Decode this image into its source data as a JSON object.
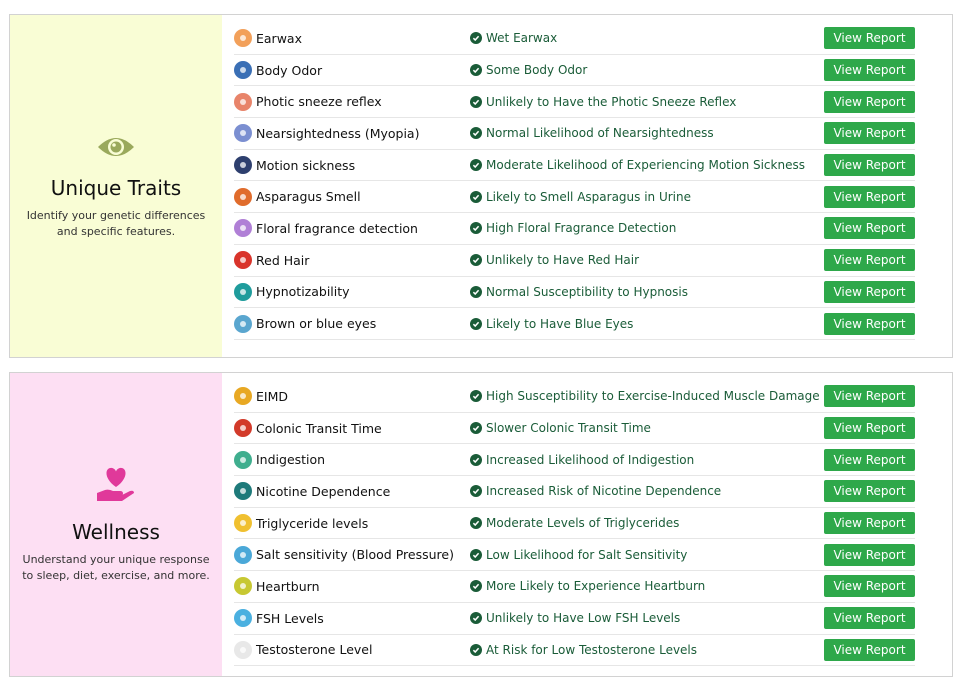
{
  "traits": {
    "title": "Unique Traits",
    "description": "Identify your genetic differences and specific features.",
    "rows": [
      {
        "name": "Earwax",
        "result": "Wet Earwax",
        "button": "View Report",
        "icon": "ear-icon",
        "color": "#f2a05a"
      },
      {
        "name": "Body Odor",
        "result": "Some Body Odor",
        "button": "View Report",
        "icon": "odor-waves-icon",
        "color": "#3a6fb5"
      },
      {
        "name": "Photic sneeze reflex",
        "result": "Unlikely to Have the Photic Sneeze Reflex",
        "button": "View Report",
        "icon": "tissue-icon",
        "color": "#e8846a"
      },
      {
        "name": "Nearsightedness (Myopia)",
        "result": "Normal Likelihood of Nearsightedness",
        "button": "View Report",
        "icon": "glasses-icon",
        "color": "#7b8fd1"
      },
      {
        "name": "Motion sickness",
        "result": "Moderate Likelihood of Experiencing Motion Sickness",
        "button": "View Report",
        "icon": "boat-icon",
        "color": "#2e3f6e"
      },
      {
        "name": "Asparagus Smell",
        "result": "Likely to Smell Asparagus in Urine",
        "button": "View Report",
        "icon": "asparagus-icon",
        "color": "#e06c2c"
      },
      {
        "name": "Floral fragrance detection",
        "result": "High Floral Fragrance Detection",
        "button": "View Report",
        "icon": "flower-icon",
        "color": "#b07fd6"
      },
      {
        "name": "Red Hair",
        "result": "Unlikely to Have Red Hair",
        "button": "View Report",
        "icon": "red-hair-icon",
        "color": "#d9342b"
      },
      {
        "name": "Hypnotizability",
        "result": "Normal Susceptibility to Hypnosis",
        "button": "View Report",
        "icon": "hypnosis-eye-icon",
        "color": "#1f9c9c"
      },
      {
        "name": "Brown or blue eyes",
        "result": "Likely to Have Blue Eyes",
        "button": "View Report",
        "icon": "blue-eye-icon",
        "color": "#5aa6cf"
      }
    ]
  },
  "wellness": {
    "title": "Wellness",
    "description": "Understand your unique response to sleep, diet, exercise, and more.",
    "rows": [
      {
        "name": "EIMD",
        "result": "High Susceptibility to Exercise-Induced Muscle Damage",
        "button": "View Report",
        "icon": "muscle-icon",
        "color": "#e8a823"
      },
      {
        "name": "Colonic Transit Time",
        "result": "Slower Colonic Transit Time",
        "button": "View Report",
        "icon": "colon-icon",
        "color": "#d23a2a"
      },
      {
        "name": "Indigestion",
        "result": "Increased Likelihood of Indigestion",
        "button": "View Report",
        "icon": "stomach-icon",
        "color": "#3fae8e"
      },
      {
        "name": "Nicotine Dependence",
        "result": "Increased Risk of Nicotine Dependence",
        "button": "View Report",
        "icon": "cigarette-icon",
        "color": "#1e7a7a"
      },
      {
        "name": "Triglyceride levels",
        "result": "Moderate Levels of Triglycerides",
        "button": "View Report",
        "icon": "lipid-drop-icon",
        "color": "#f0c030"
      },
      {
        "name": "Salt sensitivity (Blood Pressure)",
        "result": "Low Likelihood for Salt Sensitivity",
        "button": "View Report",
        "icon": "salt-shaker-icon",
        "color": "#4aa8d8"
      },
      {
        "name": "Heartburn",
        "result": "More Likely to Experience Heartburn",
        "button": "View Report",
        "icon": "heartburn-icon",
        "color": "#c7c832"
      },
      {
        "name": "FSH Levels",
        "result": "Unlikely to Have Low FSH Levels",
        "button": "View Report",
        "icon": "hormone-molecule-icon",
        "color": "#4ab0e0"
      },
      {
        "name": "Testosterone Level",
        "result": "At Risk for Low Testosterone Levels",
        "button": "View Report",
        "icon": "lightning-icon",
        "color": "#e8e8e8"
      }
    ]
  }
}
